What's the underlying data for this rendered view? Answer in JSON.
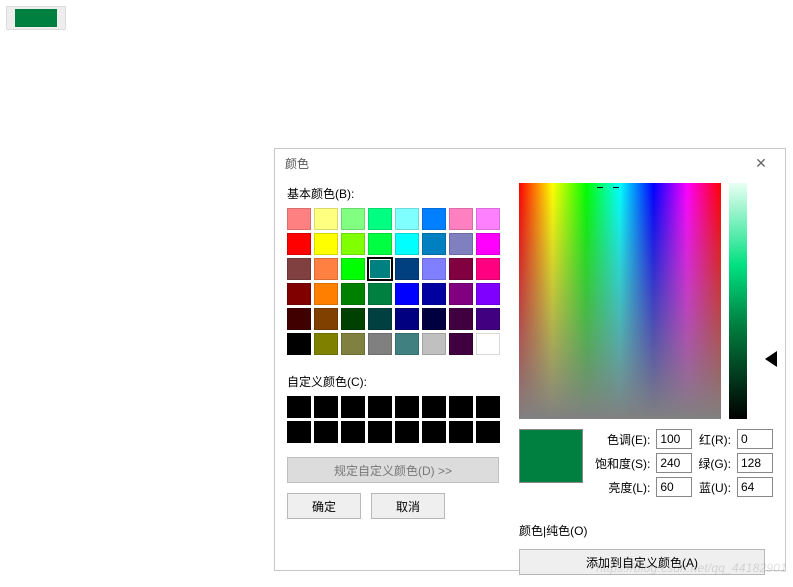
{
  "swatch_main": "#008040",
  "dialog": {
    "title": "颜色",
    "basic_label": "基本颜色(B):",
    "custom_label": "自定义颜色(C):",
    "define_label": "规定自定义颜色(D) >>",
    "solid_label": "颜色|纯色(O)",
    "ok_label": "确定",
    "cancel_label": "取消",
    "add_custom_label": "添加到自定义颜色(A)",
    "fields": {
      "hue_label": "色调(E):",
      "sat_label": "饱和度(S):",
      "lum_label": "亮度(L):",
      "red_label": "红(R):",
      "green_label": "绿(G):",
      "blue_label": "蓝(U):",
      "hue": "100",
      "sat": "240",
      "lum": "60",
      "red": "0",
      "green": "128",
      "blue": "64"
    },
    "selected_index": 19,
    "basic_colors": [
      "#ff8080",
      "#ffff80",
      "#80ff80",
      "#00ff80",
      "#80ffff",
      "#0080ff",
      "#ff80c0",
      "#ff80ff",
      "#ff0000",
      "#ffff00",
      "#80ff00",
      "#00ff40",
      "#00ffff",
      "#0080c0",
      "#8080c0",
      "#ff00ff",
      "#804040",
      "#ff8040",
      "#00ff00",
      "#008080",
      "#004080",
      "#8080ff",
      "#800040",
      "#ff0080",
      "#800000",
      "#ff8000",
      "#008000",
      "#008040",
      "#0000ff",
      "#0000a0",
      "#800080",
      "#8000ff",
      "#400000",
      "#804000",
      "#004000",
      "#004040",
      "#000080",
      "#000040",
      "#400040",
      "#400080",
      "#000000",
      "#808000",
      "#808040",
      "#808080",
      "#408080",
      "#c0c0c0",
      "#400040",
      "#ffffff"
    ],
    "custom_colors": [
      "#000000",
      "#000000",
      "#000000",
      "#000000",
      "#000000",
      "#000000",
      "#000000",
      "#000000",
      "#000000",
      "#000000",
      "#000000",
      "#000000",
      "#000000",
      "#000000",
      "#000000",
      "#000000"
    ]
  },
  "watermark": "https://blog.csdn.net/qq_44182901"
}
